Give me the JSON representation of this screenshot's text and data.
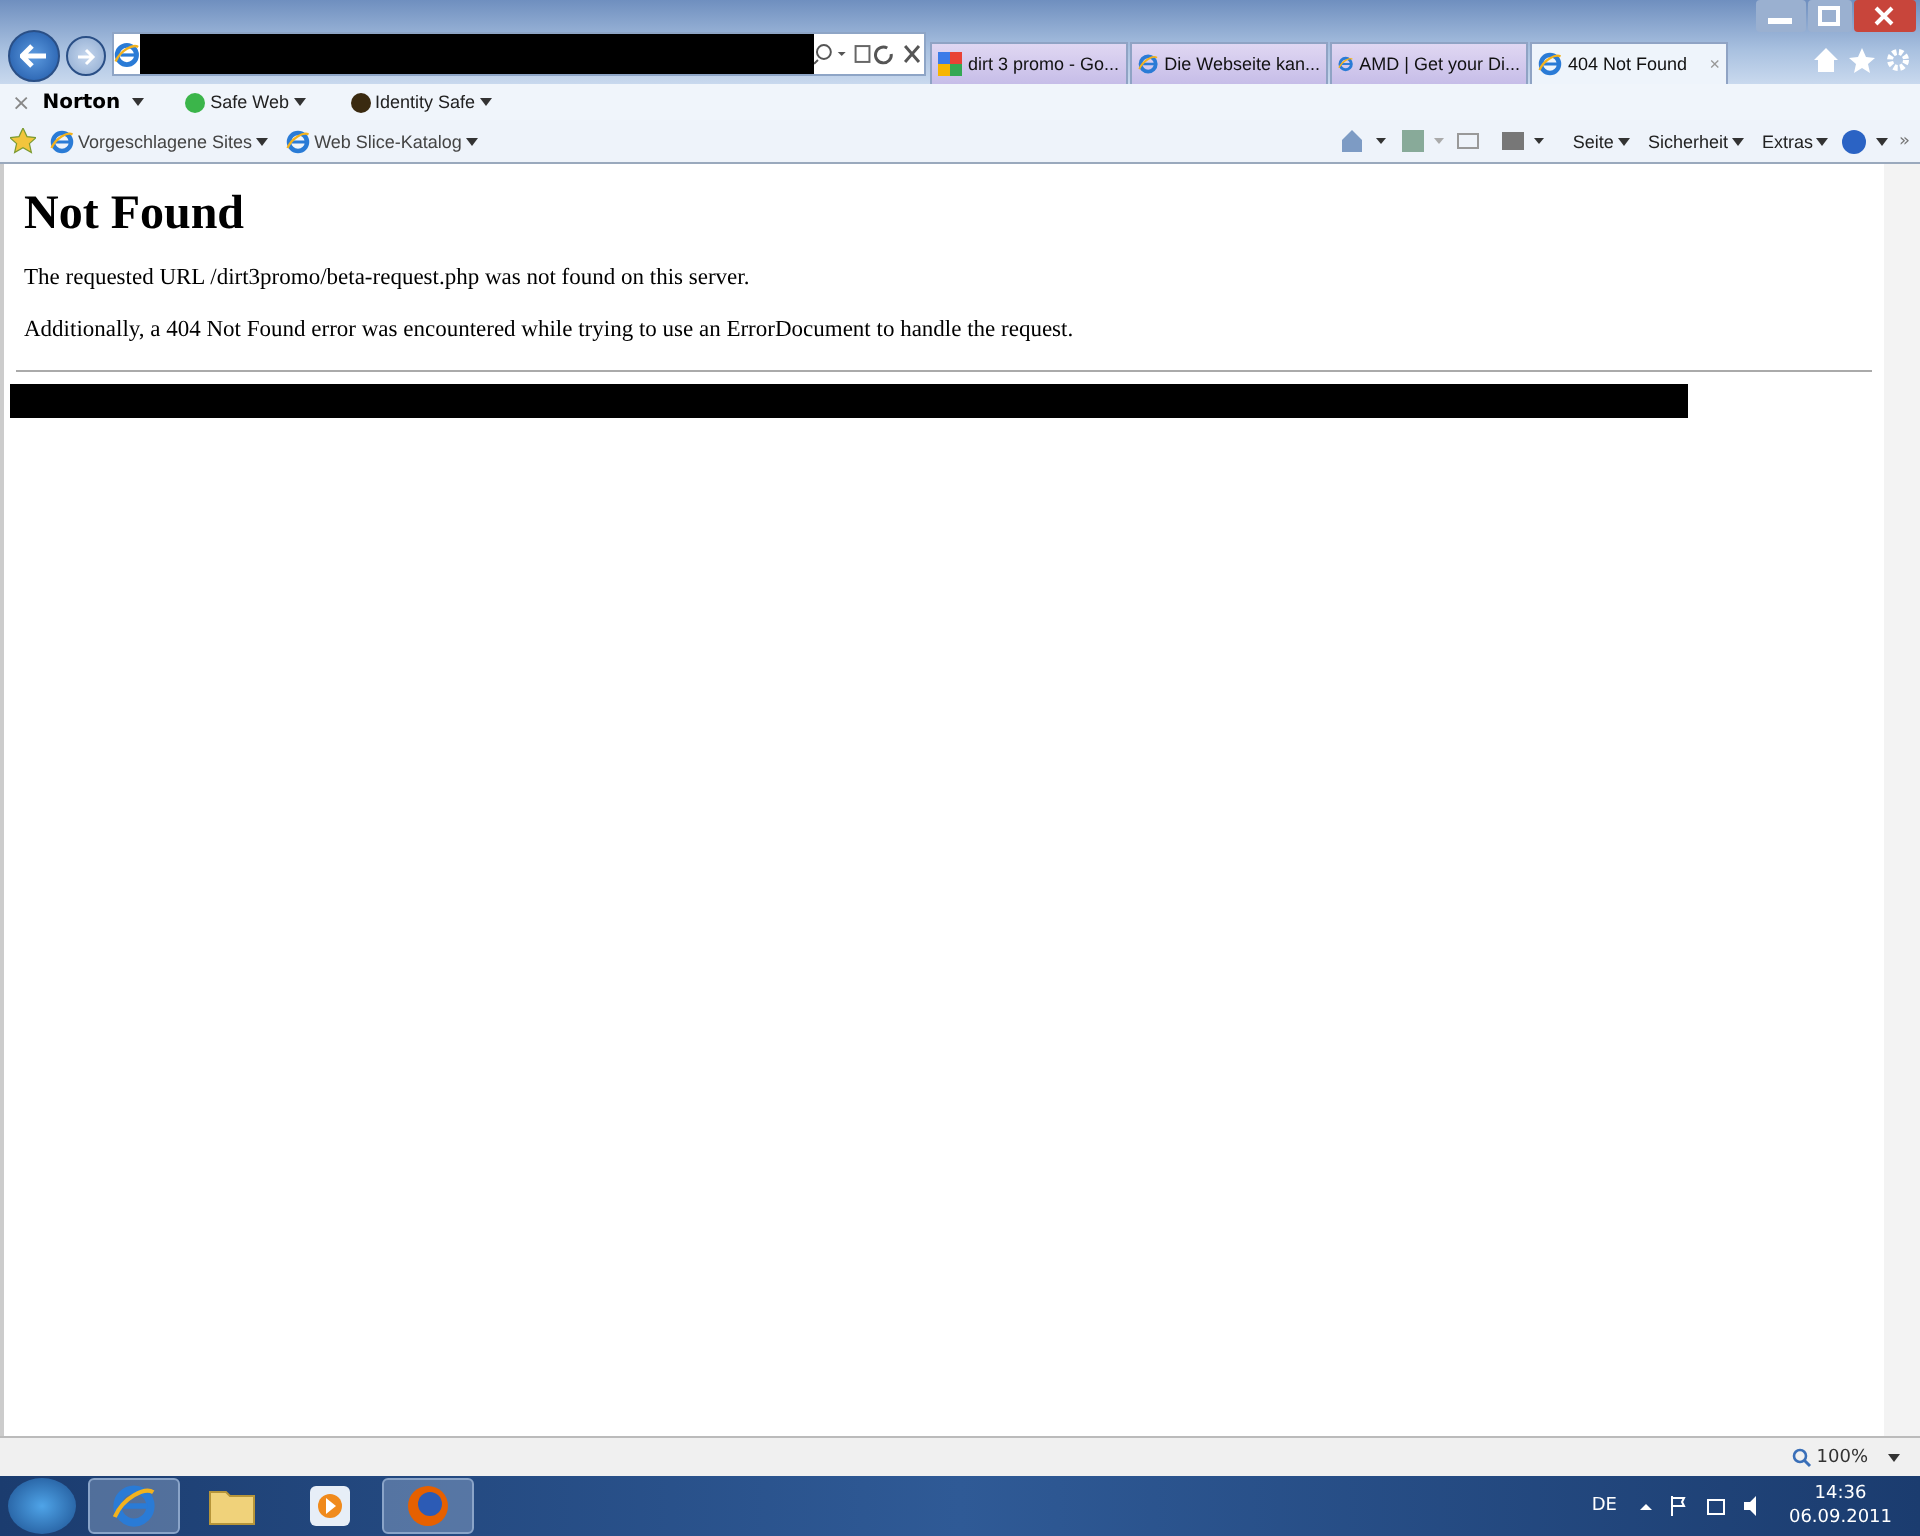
{
  "browser": {
    "tabs": [
      {
        "title": "dirt 3 promo - Go...",
        "kind": "google",
        "selected": false
      },
      {
        "title": "Die Webseite kan...",
        "kind": "ie",
        "selected": false
      },
      {
        "title": "AMD | Get your Di...",
        "kind": "ie",
        "selected": false
      },
      {
        "title": "404 Not Found",
        "kind": "ie",
        "selected": true,
        "close": "×"
      }
    ]
  },
  "norton_bar": {
    "close": "×",
    "brand": "Norton",
    "items": [
      "Safe Web",
      "Identity Safe"
    ]
  },
  "favorites_bar": {
    "links": [
      "Vorgeschlagene Sites",
      "Web Slice-Katalog"
    ],
    "commands": [
      "Seite",
      "Sicherheit",
      "Extras"
    ],
    "more": "»"
  },
  "page": {
    "heading": "Not Found",
    "paragraphs": [
      "The requested URL /dirt3promo/beta-request.php was not found on this server.",
      "Additionally, a 404 Not Found error was encountered while trying to use an ErrorDocument to handle the request."
    ]
  },
  "status_bar": {
    "zoom": "100%"
  },
  "taskbar": {
    "apps": [
      {
        "kind": "ie",
        "running": true
      },
      {
        "kind": "folder",
        "running": false
      },
      {
        "kind": "media",
        "running": false
      },
      {
        "kind": "firefox",
        "running": true
      }
    ],
    "language": "DE",
    "time": "14:36",
    "date": "06.09.2011"
  }
}
